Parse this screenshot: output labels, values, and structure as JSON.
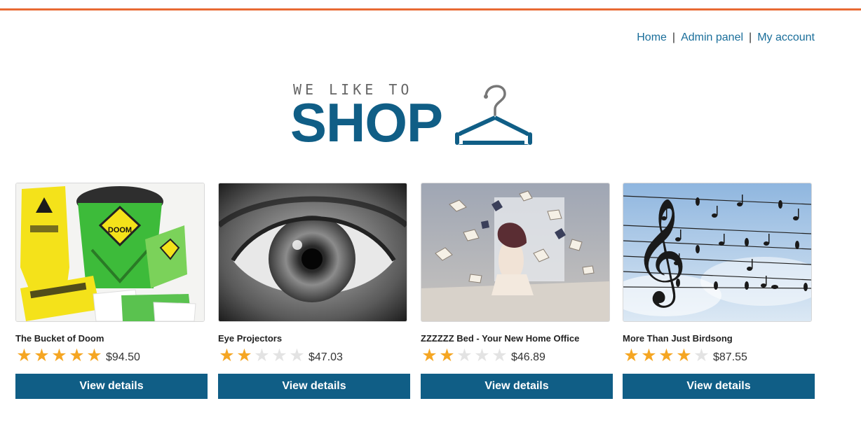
{
  "nav": {
    "items": [
      {
        "label": "Home"
      },
      {
        "label": "Admin panel"
      },
      {
        "label": "My account"
      }
    ],
    "separator": "|"
  },
  "logo": {
    "tagline": "WE LIKE TO",
    "wordmark": "SHOP",
    "icon": "hanger-icon"
  },
  "colors": {
    "accent_bar": "#e86a33",
    "brand": "#105e86",
    "link": "#1a6e9a",
    "star_on": "#f5a623",
    "star_off": "#e3e3e3"
  },
  "products": [
    {
      "name": "The Bucket of Doom",
      "rating": 5,
      "max_rating": 5,
      "price": "$94.50",
      "button": "View details",
      "image": "bucket-of-doom-game-image"
    },
    {
      "name": "Eye Projectors",
      "rating": 2,
      "max_rating": 5,
      "price": "$47.03",
      "button": "View details",
      "image": "eye-closeup-image"
    },
    {
      "name": "ZZZZZZ Bed - Your New Home Office",
      "rating": 2,
      "max_rating": 5,
      "price": "$46.89",
      "button": "View details",
      "image": "woman-bed-flying-books-image"
    },
    {
      "name": "More Than Just Birdsong",
      "rating": 4,
      "max_rating": 5,
      "price": "$87.55",
      "button": "View details",
      "image": "birds-on-wires-music-notes-image"
    }
  ]
}
